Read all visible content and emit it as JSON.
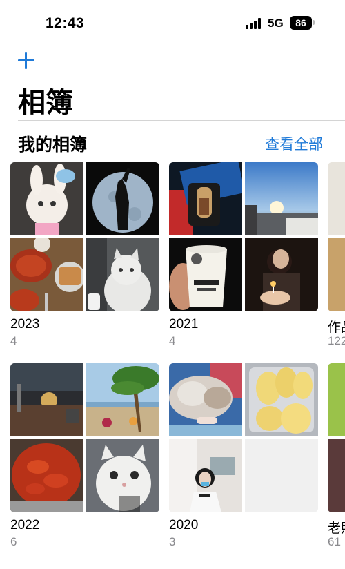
{
  "status_bar": {
    "time": "12:43",
    "network": "5G",
    "battery": "86"
  },
  "header": {
    "title": "相簿",
    "add_icon": "plus-icon"
  },
  "section": {
    "title": "我的相簿",
    "see_all": "查看全部"
  },
  "albums": [
    {
      "name": "2023",
      "count": "4"
    },
    {
      "name": "2021",
      "count": "4"
    },
    {
      "name": "作品",
      "count": "122"
    },
    {
      "name": "2022",
      "count": "6"
    },
    {
      "name": "2020",
      "count": "3"
    },
    {
      "name": "老照",
      "count": "61"
    }
  ],
  "colors": {
    "accent": "#1f7ad8",
    "secondary_text": "#8a8a8e",
    "divider": "#d4d4d4"
  }
}
